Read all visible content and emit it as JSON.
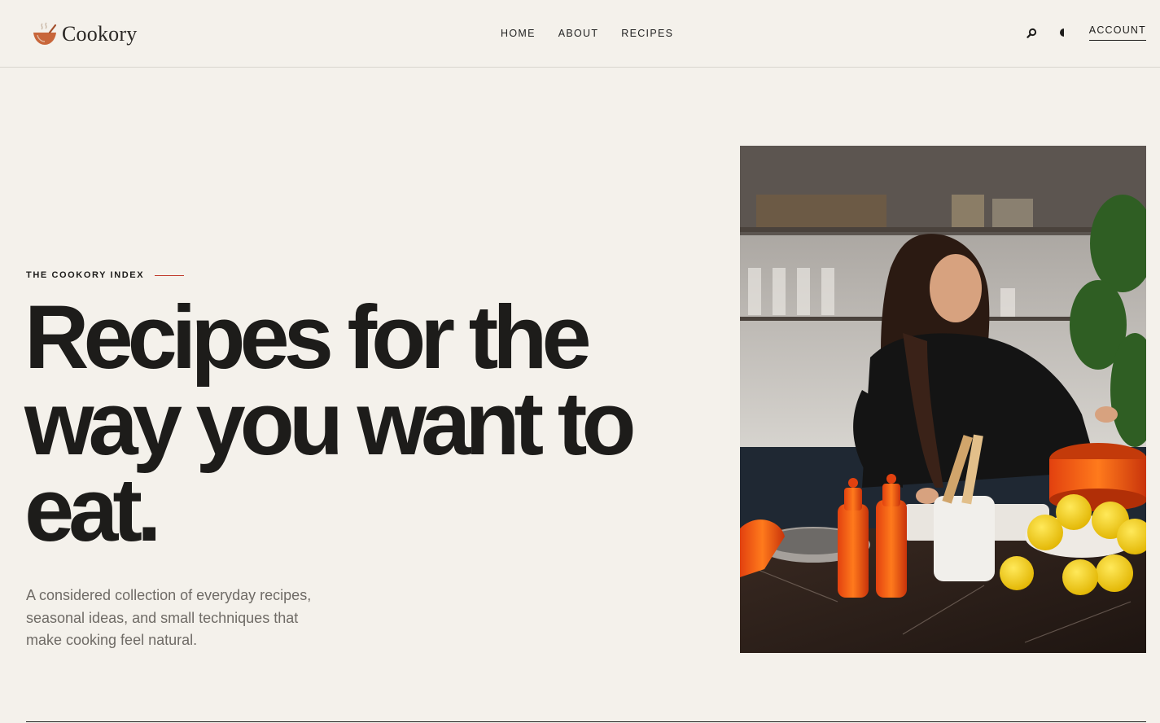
{
  "brand": {
    "name": "Cookory",
    "accent": "#c8663a"
  },
  "nav": {
    "items": [
      "HOME",
      "ABOUT",
      "RECIPES"
    ]
  },
  "tools": {
    "search_icon": "search-icon",
    "theme_icon": "half-moon-icon",
    "account_label": "ACCOUNT"
  },
  "hero": {
    "eyebrow": "THE COOKORY INDEX",
    "headline": "Recipes for the way you want to eat.",
    "intro": "A considered collection of everyday recipes, seasonal ideas, and small techniques that make cooking feel natural.",
    "eyebrow_line_color": "#c0392b",
    "image_subject": "woman cooking in kitchen with orange pots, pepper mills and lemons"
  }
}
